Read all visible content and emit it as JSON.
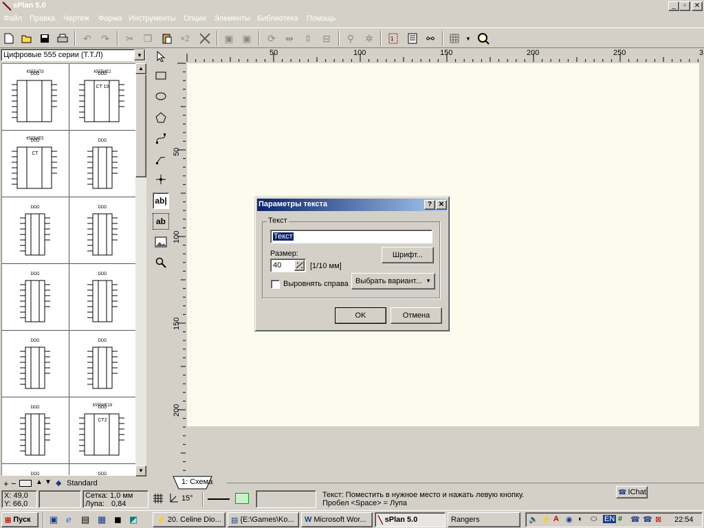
{
  "window": {
    "title": "sPlan 5.0",
    "min": "_",
    "restore": "▫",
    "close": "✕"
  },
  "menu": [
    "Файл",
    "Правка",
    "Чертёж",
    "Форма",
    "Инструменты",
    "Опции",
    "Элементы",
    "Библиотека",
    "Помощь"
  ],
  "toolbar": {
    "x2_label": "×2"
  },
  "library": {
    "selected": "Цифровые 555 серии (Т.Т.Л)",
    "cells": [
      "К555АП3",
      "К555ИЕ2",
      "К555ИЕ5",
      "",
      "",
      "",
      "",
      "",
      "",
      "",
      "",
      "К555ИЕ19"
    ],
    "cell_ct_labels": [
      "",
      "CT 10",
      "CT",
      "",
      "",
      "",
      "",
      "",
      "",
      "",
      "",
      "CT2"
    ],
    "bottom_label": "Standard"
  },
  "ruler": {
    "h_ticks": [
      "50",
      "100",
      "150",
      "200",
      "250",
      "3"
    ],
    "v_ticks": [
      "50",
      "100",
      "150",
      "200"
    ]
  },
  "tab": {
    "label": "1: Схема"
  },
  "status": {
    "x": "X: 49,0",
    "y": "Y: 66,0",
    "grid": "Сетка: 1,0 мм",
    "zoom": "Лупа:",
    "zoom_value": "0,84",
    "angle": "15°",
    "hint1": "Текст: Поместить в нужное место и нажать левую кнопку.",
    "hint2": "Пробел <Space> = Лупа",
    "ichat": "IChat"
  },
  "dialog": {
    "title": "Параметры текста",
    "help": "?",
    "close": "✕",
    "group_label": "Текст",
    "text_value": "Текст",
    "size_label": "Размер:",
    "size_value": "40",
    "size_unit": "[1/10 мм]",
    "font_button": "Шрифт...",
    "align_right": "Выровнять справа",
    "variant_button": "Выбрать вариант...",
    "ok": "OK",
    "cancel": "Отмена"
  },
  "taskbar": {
    "start": "Пуск",
    "tasks": [
      "20. Celine Dio...",
      "{E:\\Games\\Ko...",
      "Microsoft Wor...",
      "sPlan 5.0",
      "Rangers"
    ],
    "lang": "EN",
    "clock": "22:54"
  },
  "colors": {
    "title_active": "#0a246a",
    "sheet": "#fcfcee",
    "face": "#d4d0c8"
  }
}
